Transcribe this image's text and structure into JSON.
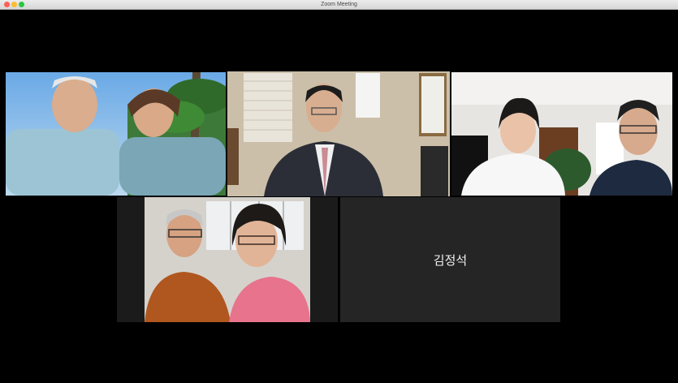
{
  "window": {
    "title": "Zoom Meeting"
  },
  "participants": [
    {
      "id": "p1",
      "label": ""
    },
    {
      "id": "p2",
      "label": ""
    },
    {
      "id": "p3",
      "label": ""
    },
    {
      "id": "p4",
      "label": ""
    },
    {
      "id": "p5",
      "name": "김정석"
    }
  ],
  "colors": {
    "active_speaker_border": "#d7e24a",
    "name_tile_bg": "#252525"
  }
}
